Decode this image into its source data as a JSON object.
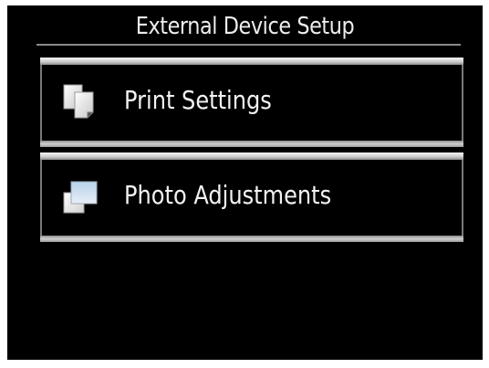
{
  "screen": {
    "title": "External Device Setup"
  },
  "menu": {
    "items": [
      {
        "label": "Print Settings",
        "icon": "print-settings-icon"
      },
      {
        "label": "Photo Adjustments",
        "icon": "photo-adjustments-icon"
      }
    ]
  },
  "colors": {
    "background": "#000000",
    "text": "#f2f2f2",
    "bar_highlight": "#f4f4f4",
    "border": "#7a7a7a"
  }
}
